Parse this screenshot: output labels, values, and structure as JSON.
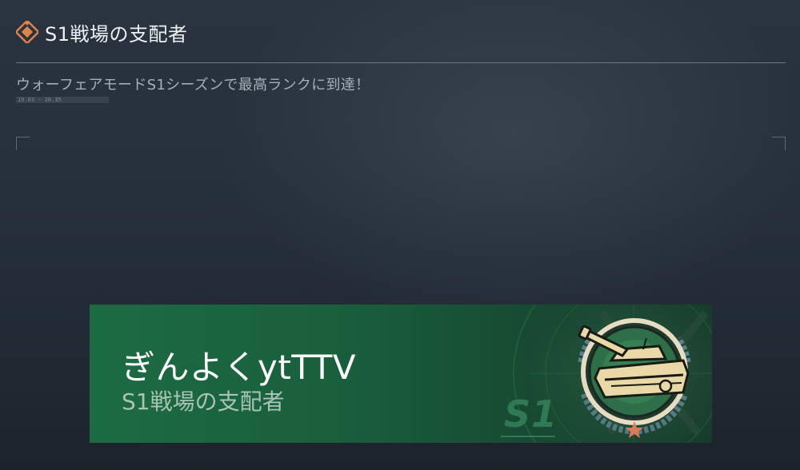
{
  "header": {
    "title": "S1戦場の支配者",
    "icon": "diamond-emblem-icon",
    "accent_color": "#e0834a"
  },
  "description": "ウォーフェアモードS1シーズンで最高ランクに到達！",
  "date_range": "19.03 - 20.35",
  "banner": {
    "player_name": "ぎんよくytTTV",
    "title": "S1戦場の支配者",
    "season_label": "S1",
    "emblem_icon": "tank-medal-icon",
    "background_color": "#1c6b43"
  }
}
